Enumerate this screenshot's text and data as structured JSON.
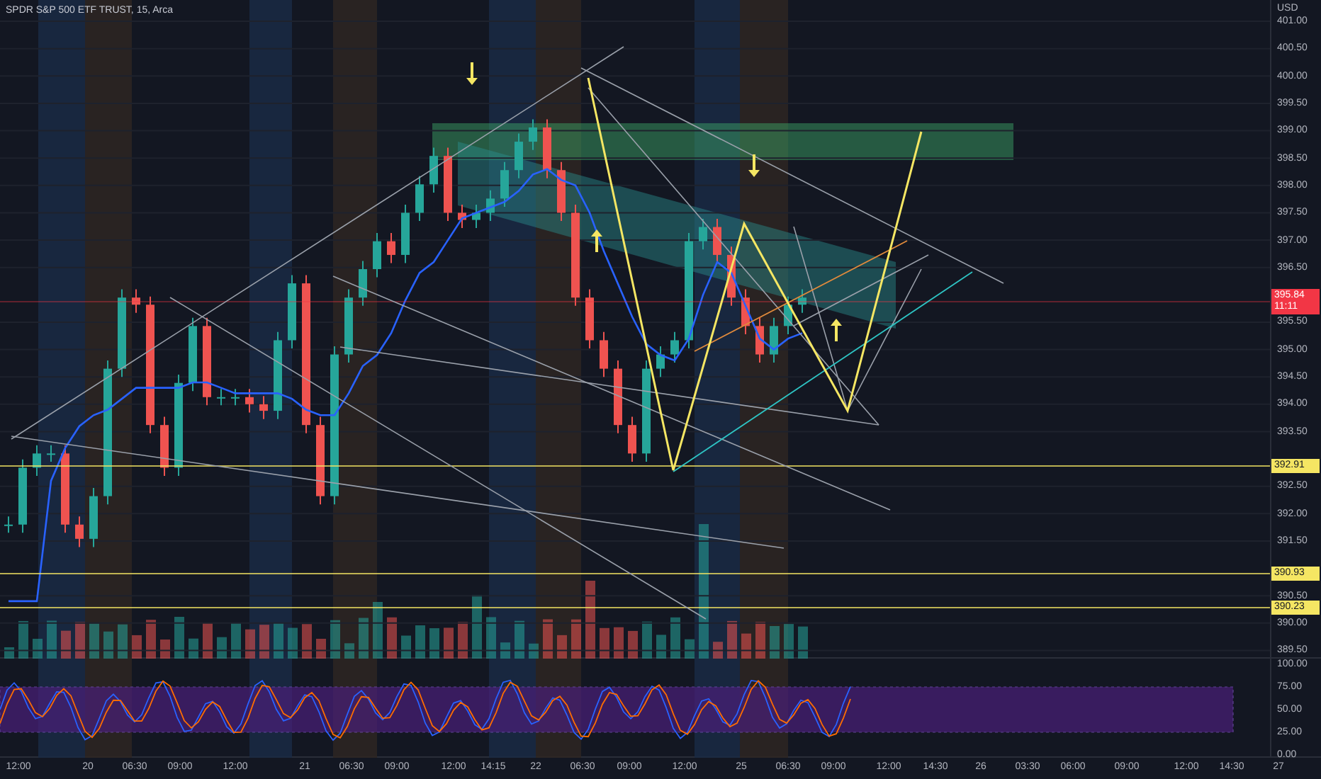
{
  "chart_title": "SPDR S&P 500 ETF TRUST, 15, Arca",
  "currency": "USD",
  "price_axis": [
    "401.00",
    "400.50",
    "400.00",
    "399.50",
    "399.00",
    "398.50",
    "398.00",
    "397.50",
    "397.00",
    "396.50",
    "395.50",
    "395.00",
    "394.50",
    "394.00",
    "393.50",
    "392.50",
    "392.00",
    "391.50",
    "390.50",
    "390.00",
    "389.50"
  ],
  "price_tags": [
    {
      "kind": "last",
      "label": "395.84",
      "countdown": "11:11",
      "color": "#f23645"
    },
    {
      "kind": "level",
      "label": "392.91",
      "color": "#f5e663"
    },
    {
      "kind": "level",
      "label": "390.93",
      "color": "#f5e663"
    },
    {
      "kind": "level",
      "label": "390.23",
      "color": "#f5e663"
    }
  ],
  "oscillator": {
    "yticks": [
      "100.00",
      "75.00",
      "50.00",
      "25.00",
      "0.00"
    ]
  },
  "time_axis": [
    "12:00",
    "20",
    "06:30",
    "09:00",
    "12:00",
    "21",
    "06:30",
    "09:00",
    "12:00",
    "14:15",
    "22",
    "06:30",
    "09:00",
    "12:00",
    "25",
    "06:30",
    "09:00",
    "12:00",
    "14:30",
    "26",
    "03:30",
    "06:00",
    "09:00",
    "12:00",
    "14:30",
    "27"
  ]
}
